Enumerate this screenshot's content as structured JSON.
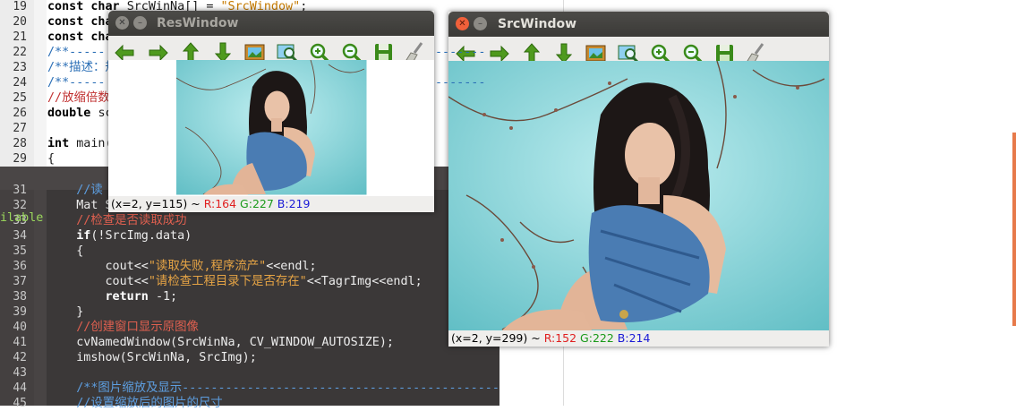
{
  "editor_top": {
    "lines": [
      {
        "num": "19",
        "parts": [
          [
            "kw",
            "const "
          ],
          [
            "kw",
            "char "
          ],
          [
            "txt",
            "SrcWinNa[] = "
          ],
          [
            "str",
            "\"SrcWindow\""
          ],
          [
            "txt",
            ";"
          ]
        ]
      },
      {
        "num": "20",
        "parts": [
          [
            "kw",
            "const "
          ],
          [
            "kw",
            "cha"
          ]
        ]
      },
      {
        "num": "21",
        "parts": [
          [
            "kw",
            "const "
          ],
          [
            "kw",
            "cha"
          ]
        ]
      },
      {
        "num": "22",
        "parts": [
          [
            "cmt",
            "/**-----"
          ]
        ]
      },
      {
        "num": "23",
        "parts": [
          [
            "cmt",
            "/**描述：规"
          ]
        ]
      },
      {
        "num": "24",
        "parts": [
          [
            "cmt",
            "/**-----"
          ]
        ]
      },
      {
        "num": "25",
        "parts": [
          [
            "cmtcn",
            "//放缩倍数"
          ]
        ]
      },
      {
        "num": "26",
        "parts": [
          [
            "kw",
            "double "
          ],
          [
            "txt",
            "sc"
          ]
        ]
      },
      {
        "num": "27",
        "parts": [
          [
            "txt",
            ""
          ]
        ]
      },
      {
        "num": "28",
        "parts": [
          [
            "kw",
            "int "
          ],
          [
            "txt",
            "main("
          ]
        ]
      },
      {
        "num": "29",
        "parts": [
          [
            "txt",
            "{"
          ]
        ]
      }
    ],
    "right_dashes_1": "-------",
    "right_dashes_2": "-------"
  },
  "editor_bottom": {
    "lines": [
      {
        "num": "31",
        "parts": [
          [
            "bcmt",
            "    //读"
          ]
        ]
      },
      {
        "num": "32",
        "parts": [
          [
            "txt",
            "    Mat S"
          ]
        ]
      },
      {
        "num": "33",
        "parts": [
          [
            "bcmtcn",
            "    //检查是否读取成功"
          ]
        ]
      },
      {
        "num": "34",
        "parts": [
          [
            "bkw",
            "    if"
          ],
          [
            "txt",
            "(!SrcImg.data)"
          ]
        ]
      },
      {
        "num": "35",
        "parts": [
          [
            "txt",
            "    {"
          ]
        ]
      },
      {
        "num": "36",
        "parts": [
          [
            "txt",
            "        cout<<"
          ],
          [
            "bstr",
            "\"读取失败,程序流产\""
          ],
          [
            "txt",
            "<<endl;"
          ]
        ]
      },
      {
        "num": "37",
        "parts": [
          [
            "txt",
            "        cout<<"
          ],
          [
            "bstr",
            "\"请检查工程目录下是否存在\""
          ],
          [
            "txt",
            "<<TagrImg<<endl;"
          ]
        ]
      },
      {
        "num": "38",
        "parts": [
          [
            "bkw",
            "        return "
          ],
          [
            "txt",
            "-1;"
          ]
        ]
      },
      {
        "num": "39",
        "parts": [
          [
            "txt",
            "    }"
          ]
        ]
      },
      {
        "num": "40",
        "parts": [
          [
            "bcmtcn",
            "    //创建窗口显示原图像"
          ]
        ]
      },
      {
        "num": "41",
        "parts": [
          [
            "txt",
            "    cvNamedWindow(SrcWinNa, CV_WINDOW_AUTOSIZE);"
          ]
        ]
      },
      {
        "num": "42",
        "parts": [
          [
            "txt",
            "    imshow(SrcWinNa, SrcImg);"
          ]
        ]
      },
      {
        "num": "43",
        "parts": [
          [
            "txt",
            ""
          ]
        ]
      },
      {
        "num": "44",
        "parts": [
          [
            "bcmt",
            "    /**图片缩放及显示-----------------------------------------------**/"
          ]
        ]
      },
      {
        "num": "45",
        "parts": [
          [
            "bcmt",
            "    //设置缩放后的图片的尺寸"
          ]
        ]
      }
    ],
    "side_text": "ilable"
  },
  "res_window": {
    "title": "ResWindow",
    "status": {
      "coords": "(x=2, y=115) ~ ",
      "r": "R:164",
      "g": "G:227",
      "b": "B:219"
    }
  },
  "src_window": {
    "title": "SrcWindow",
    "status": {
      "coords": "(x=2, y=299) ~ ",
      "r": "R:152",
      "g": "G:222",
      "b": "B:214"
    }
  },
  "toolbar_icons": [
    "arrow-left-icon",
    "arrow-right-icon",
    "arrow-up-icon",
    "arrow-down-icon",
    "image-icon",
    "zoom-fit-icon",
    "zoom-in-icon",
    "zoom-out-icon",
    "save-icon",
    "brush-icon"
  ],
  "colors": {
    "accent_green": "#4a9a1a",
    "close_button": "#f0603a",
    "titlebar": "#3c3b37",
    "photo_bg": "#7fcfd3"
  }
}
